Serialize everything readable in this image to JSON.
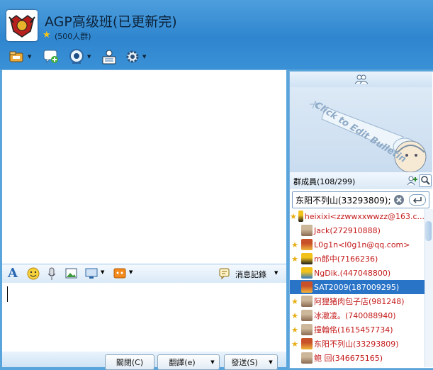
{
  "window": {
    "title": "AGP高级班(已更新完)",
    "group_size": "(500人群)"
  },
  "toolbar": {
    "icons": [
      "folder-icon",
      "chat-add-icon",
      "webcam-icon",
      "member-card-icon",
      "settings-gear-icon"
    ]
  },
  "input_toolbar": {
    "history_label": "消息記錄"
  },
  "buttons": {
    "close_label": "關閉(C)",
    "translate_label": "翻譯(e)",
    "send_label": "發送(S)"
  },
  "right_panel": {
    "bulletin_text": "Click to Edit Bulletin",
    "members_title": "群成員(108/299)",
    "search_value": "东阳不列山(33293809);"
  },
  "members": [
    {
      "name": "heixixi<zzwwxxwwzz@163.c...",
      "star": true,
      "avatar": "penguin",
      "color": "#c41a1a",
      "selected": false
    },
    {
      "name": "Jack(272910888)",
      "star": false,
      "avatar": "photo",
      "color": "#c41a1a",
      "selected": false
    },
    {
      "name": "L0g1n<l0g1n@qq.com>",
      "star": true,
      "avatar": "cartoon",
      "color": "#c41a1a",
      "selected": false
    },
    {
      "name": "m郎中(7166236)",
      "star": true,
      "avatar": "penguin",
      "color": "#c41a1a",
      "selected": false
    },
    {
      "name": "NgDik.(447048800)",
      "star": false,
      "avatar": "penguin-blue",
      "color": "#c41a1a",
      "selected": false
    },
    {
      "name": "SAT2009(187009295)",
      "star": false,
      "avatar": "cartoon",
      "color": "#ffffff",
      "selected": true
    },
    {
      "name": "阿狸猪肉包子店(981248)",
      "star": true,
      "avatar": "photo",
      "color": "#c41a1a",
      "selected": false
    },
    {
      "name": "冰澈凌。(740088940)",
      "star": true,
      "avatar": "photo",
      "color": "#c41a1a",
      "selected": false
    },
    {
      "name": "撞翰佲(1615457734)",
      "star": true,
      "avatar": "photo",
      "color": "#c41a1a",
      "selected": false
    },
    {
      "name": "东阳不列山(33293809)",
      "star": true,
      "avatar": "cartoon",
      "color": "#c41a1a",
      "selected": false
    },
    {
      "name": "鲍 回(346675165)",
      "star": false,
      "avatar": "photo",
      "color": "#c41a1a",
      "selected": false
    }
  ],
  "colors": {
    "header_blue": "#3a91d6",
    "member_name": "#c41a1a",
    "selection": "#2a74c8"
  }
}
